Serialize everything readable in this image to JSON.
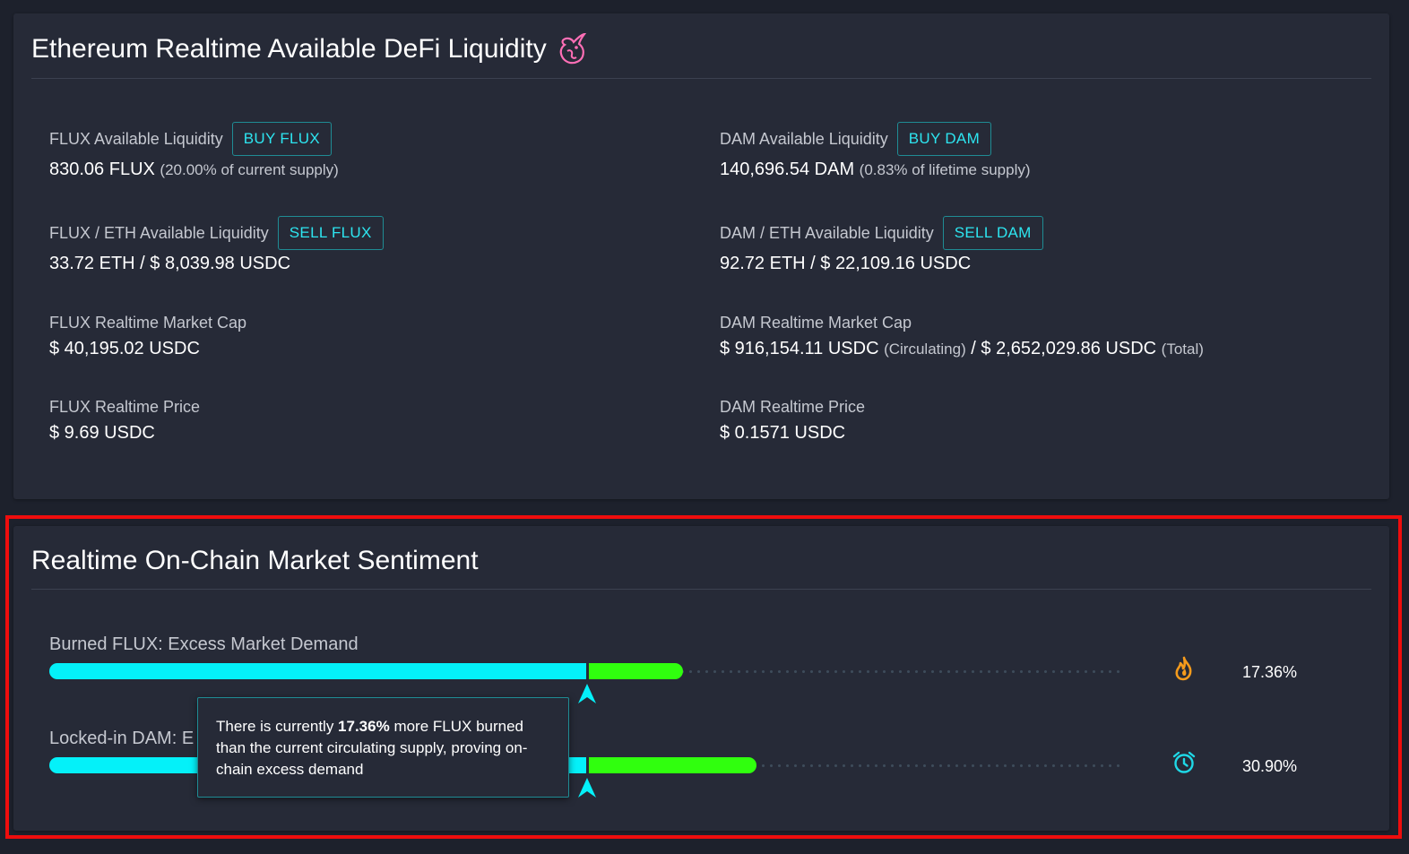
{
  "liquidity": {
    "title": "Ethereum Realtime Available DeFi Liquidity",
    "title_icon": "unicorn-icon",
    "flux_available": {
      "label": "FLUX Available Liquidity",
      "button": "BUY FLUX",
      "value": "830.06 FLUX",
      "note": "(20.00% of current supply)"
    },
    "dam_available": {
      "label": "DAM Available Liquidity",
      "button": "BUY DAM",
      "value": "140,696.54 DAM",
      "note": "(0.83% of lifetime supply)"
    },
    "flux_eth": {
      "label": "FLUX / ETH Available Liquidity",
      "button": "SELL FLUX",
      "value": "33.72 ETH / $ 8,039.98 USDC"
    },
    "dam_eth": {
      "label": "DAM / ETH Available Liquidity",
      "button": "SELL DAM",
      "value": "92.72 ETH / $ 22,109.16 USDC"
    },
    "flux_mcap": {
      "label": "FLUX Realtime Market Cap",
      "value": "$ 40,195.02 USDC"
    },
    "dam_mcap": {
      "label": "DAM Realtime Market Cap",
      "value_circ": "$ 916,154.11 USDC",
      "circ_note": "(Circulating)",
      "separator": "/",
      "value_total": "$ 2,652,029.86 USDC",
      "total_note": "(Total)"
    },
    "flux_price": {
      "label": "FLUX Realtime Price",
      "value": "$ 9.69 USDC"
    },
    "dam_price": {
      "label": "DAM Realtime Price",
      "value": "$ 0.1571 USDC"
    }
  },
  "sentiment": {
    "title": "Realtime On-Chain Market Sentiment",
    "burned": {
      "label": "Burned FLUX: Excess Market Demand",
      "percent": "17.36%",
      "fill_percent": 17.36,
      "icon": "flame-icon",
      "icon_color": "#f59b1c"
    },
    "locked": {
      "label_visible": "Locked-in DAM: E",
      "percent": "30.90%",
      "fill_percent": 30.9,
      "icon": "alarm-clock-icon",
      "icon_color": "#1fd8e6"
    },
    "tooltip": {
      "pre": "There is currently ",
      "bold": "17.36%",
      "post": " more FLUX burned than the current circulating supply, proving on-chain excess demand"
    }
  },
  "colors": {
    "background": "#1d212c",
    "card": "#262a37",
    "accent_cyan": "#04f1f9",
    "accent_green": "#30ff0e",
    "button_text": "#2de5f0",
    "highlight": "#ee0d0d"
  }
}
